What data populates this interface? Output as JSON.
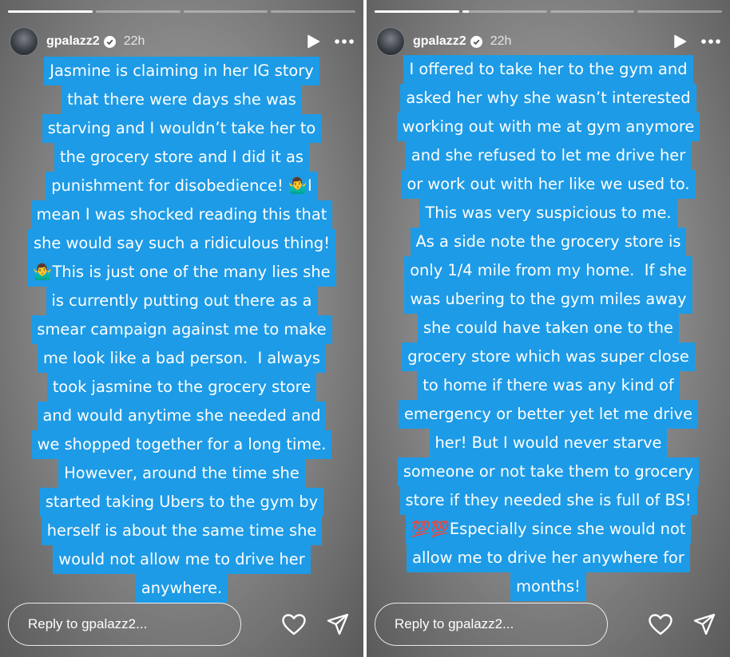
{
  "stories": [
    {
      "user": {
        "username": "gpalazz2",
        "time": "22h",
        "verified": true
      },
      "progress": [
        1,
        0,
        0,
        0
      ],
      "text_lines": [
        "Jasmine is claiming in her IG story",
        "that there were days she was",
        "starving and I wouldn’t take her to",
        "the grocery store and I did it as",
        "punishment for disobedience! 🤷‍♂️I",
        "mean I was shocked reading this that",
        "she would say such a ridiculous thing!",
        "🤷‍♂️This is just one of the many lies she",
        "is currently putting out there as a",
        "smear campaign against me to make",
        "me look like a bad person.  I always",
        "took jasmine to the grocery store",
        "and would anytime she needed and",
        "we shopped together for a long time.",
        "However, around the time she",
        "started taking Ubers to the gym by",
        "herself is about the same time she",
        "would not allow me to drive her",
        "anywhere."
      ],
      "reply_placeholder": "Reply to gpalazz2..."
    },
    {
      "user": {
        "username": "gpalazz2",
        "time": "22h",
        "verified": true
      },
      "progress": [
        1,
        0.08,
        0,
        0
      ],
      "text_lines": [
        "I offered to take her to the gym and",
        "asked her why she wasn’t interested",
        "working out with me at gym anymore",
        "and she refused to let me drive her",
        "or work out with her like we used to.",
        "This was very suspicious to me.",
        "As a side note the grocery store is",
        "only 1/4 mile from my home.  If she",
        "was ubering to the gym miles away",
        "she could have taken one to the",
        "grocery store which was super close",
        "to home if there was any kind of",
        "emergency or better yet let me drive",
        "her! But I would never starve",
        "someone or not take them to grocery",
        "store if they needed she is full of BS!",
        "💯💯Especially since she would not",
        "allow me to drive her anywhere for",
        "months!"
      ],
      "reply_placeholder": "Reply to gpalazz2..."
    }
  ],
  "colors": {
    "text_highlight": "#1d9be6",
    "text": "#ffffff"
  },
  "icons": [
    "play-icon",
    "more-icon",
    "verified-badge-icon",
    "heart-icon",
    "send-icon"
  ]
}
